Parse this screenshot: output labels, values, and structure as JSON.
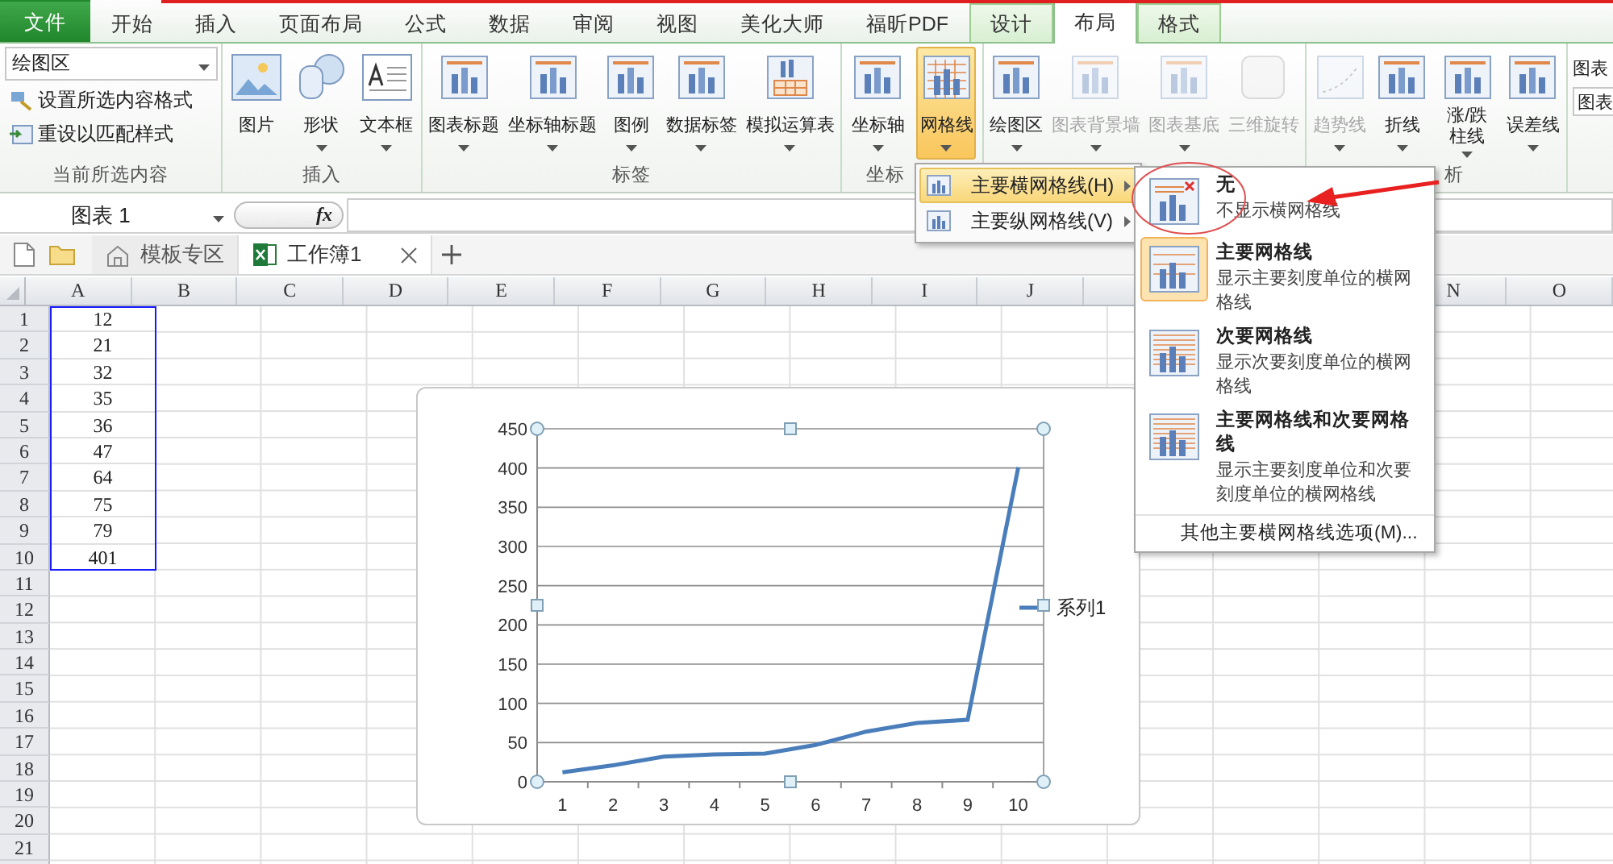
{
  "ribbon_tabs": [
    {
      "label": "文件",
      "kind": "file",
      "selected": false
    },
    {
      "label": "开始",
      "kind": "plain",
      "selected": false
    },
    {
      "label": "插入",
      "kind": "plain",
      "selected": false
    },
    {
      "label": "页面布局",
      "kind": "plain",
      "selected": false
    },
    {
      "label": "公式",
      "kind": "plain",
      "selected": false
    },
    {
      "label": "数据",
      "kind": "plain",
      "selected": false
    },
    {
      "label": "审阅",
      "kind": "plain",
      "selected": false
    },
    {
      "label": "视图",
      "kind": "plain",
      "selected": false
    },
    {
      "label": "美化大师",
      "kind": "plain",
      "selected": false
    },
    {
      "label": "福昕PDF",
      "kind": "plain",
      "selected": false
    },
    {
      "label": "设计",
      "kind": "context",
      "selected": false
    },
    {
      "label": "布局",
      "kind": "context",
      "selected": true
    },
    {
      "label": "格式",
      "kind": "context",
      "selected": false
    }
  ],
  "ribbon_groups": [
    {
      "kind": "selection",
      "label": "当前所选内容",
      "dropdown": "绘图区",
      "commands": [
        {
          "label": "设置所选内容格式",
          "kind": "format"
        },
        {
          "label": "重设以匹配样式",
          "kind": "reset"
        }
      ]
    },
    {
      "kind": "buttons",
      "label": "插入",
      "buttons": [
        {
          "label": "图片",
          "kind": "picture",
          "dropdown": false,
          "disabled": false,
          "selected": false
        },
        {
          "label": "形状",
          "kind": "shape",
          "dropdown": true,
          "disabled": false,
          "selected": false
        },
        {
          "label": "文本框",
          "kind": "textbox",
          "dropdown": true,
          "disabled": false,
          "selected": false
        }
      ]
    },
    {
      "kind": "buttons",
      "label": "标签",
      "buttons": [
        {
          "label": "图表标题",
          "kind": "chart",
          "dropdown": true,
          "disabled": false,
          "selected": false
        },
        {
          "label": "坐标轴标题",
          "kind": "chart",
          "dropdown": true,
          "disabled": false,
          "selected": false
        },
        {
          "label": "图例",
          "kind": "chart",
          "dropdown": true,
          "disabled": false,
          "selected": false
        },
        {
          "label": "数据标签",
          "kind": "chart",
          "dropdown": true,
          "disabled": false,
          "selected": false
        },
        {
          "label": "模拟运算表",
          "kind": "table",
          "dropdown": true,
          "disabled": false,
          "selected": false
        }
      ]
    },
    {
      "kind": "buttons",
      "label": "坐标",
      "buttons": [
        {
          "label": "坐标轴",
          "kind": "chart",
          "dropdown": true,
          "disabled": false,
          "selected": false
        },
        {
          "label": "网格线",
          "kind": "grid",
          "dropdown": true,
          "disabled": false,
          "selected": true
        }
      ]
    },
    {
      "kind": "buttons",
      "buttons": [
        {
          "label": "绘图区",
          "kind": "chart",
          "dropdown": true,
          "disabled": false,
          "selected": false
        },
        {
          "label": "图表背景墙",
          "kind": "chart",
          "dropdown": true,
          "disabled": true,
          "selected": false
        },
        {
          "label": "图表基底",
          "kind": "chart",
          "dropdown": true,
          "disabled": true,
          "selected": false
        },
        {
          "label": "三维旋转",
          "kind": "cube",
          "dropdown": false,
          "disabled": true,
          "selected": false
        }
      ]
    },
    {
      "kind": "buttons",
      "label": "析",
      "buttons": [
        {
          "label": "趋势线",
          "kind": "trend",
          "dropdown": true,
          "disabled": true,
          "selected": false
        },
        {
          "label": "折线",
          "kind": "chart",
          "dropdown": true,
          "disabled": false,
          "selected": false
        },
        {
          "label": "涨/跌柱线",
          "kind": "chart",
          "dropdown": true,
          "disabled": false,
          "selected": false
        },
        {
          "label": "误差线",
          "kind": "chart",
          "dropdown": true,
          "disabled": false,
          "selected": false
        }
      ]
    },
    {
      "kind": "properties",
      "title": "图表",
      "field_value": "图表"
    }
  ],
  "formula_bar": {
    "name_box": "图表 1",
    "function_label": "fx"
  },
  "doc_tabs": [
    {
      "label": "模板专区",
      "kind": "home",
      "selected": false
    },
    {
      "label": "工作簿1",
      "kind": "workbook",
      "selected": true
    }
  ],
  "sheet": {
    "columns": [
      "A",
      "B",
      "C",
      "D",
      "E",
      "F",
      "G",
      "H",
      "I",
      "J",
      null,
      null,
      null,
      "N",
      "O"
    ],
    "rows": [
      {
        "number": "1",
        "value": "12"
      },
      {
        "number": "2",
        "value": "21"
      },
      {
        "number": "3",
        "value": "32"
      },
      {
        "number": "4",
        "value": "35"
      },
      {
        "number": "5",
        "value": "36"
      },
      {
        "number": "6",
        "value": "47"
      },
      {
        "number": "7",
        "value": "64"
      },
      {
        "number": "8",
        "value": "75"
      },
      {
        "number": "9",
        "value": "79"
      },
      {
        "number": "10",
        "value": "401"
      },
      {
        "number": "11"
      },
      {
        "number": "12"
      },
      {
        "number": "13"
      },
      {
        "number": "14"
      },
      {
        "number": "15"
      },
      {
        "number": "16"
      },
      {
        "number": "17"
      },
      {
        "number": "18"
      },
      {
        "number": "19"
      },
      {
        "number": "20"
      },
      {
        "number": "21"
      }
    ]
  },
  "chart": {
    "chart_data": {
      "type": "line",
      "grid": true,
      "categories": [
        "1",
        "2",
        "3",
        "4",
        "5",
        "6",
        "7",
        "8",
        "9",
        "10"
      ],
      "series": [
        {
          "name": "系列1",
          "color": "#4a7ebb",
          "values": [
            12,
            21,
            32,
            35,
            36,
            47,
            64,
            75,
            79,
            401
          ]
        }
      ],
      "ylim": [
        0,
        450
      ],
      "yticks": [
        0,
        50,
        100,
        150,
        200,
        250,
        300,
        350,
        400,
        450
      ]
    }
  },
  "gridlines_menu": {
    "items": [
      {
        "label": "主要横网格线(H)",
        "selected": true
      },
      {
        "label": "主要纵网格线(V)",
        "selected": false
      }
    ]
  },
  "horizontal_gridlines_submenu": {
    "options": [
      {
        "title": "无",
        "description": "不显示横网格线",
        "kind": "none",
        "selected": false
      },
      {
        "title": "主要网格线",
        "description": "显示主要刻度单位的横网格线",
        "kind": "major",
        "selected": true
      },
      {
        "title": "次要网格线",
        "description": "显示次要刻度单位的横网格线",
        "kind": "minor",
        "selected": false
      },
      {
        "title": "主要网格线和次要网格线",
        "description": "显示主要刻度单位和次要刻度单位的横网格线",
        "kind": "both",
        "selected": false
      }
    ],
    "footer": "其他主要横网格线选项(M)..."
  }
}
